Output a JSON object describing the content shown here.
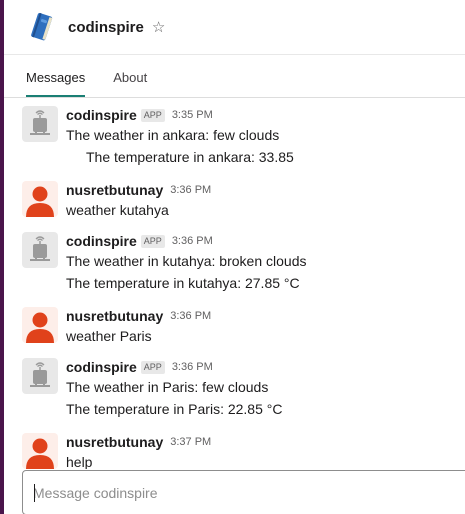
{
  "header": {
    "app_name": "codinspire",
    "logo_icon": "notebook-icon",
    "star_icon": "star-outline-icon"
  },
  "tabs": [
    {
      "label": "Messages",
      "active": true
    },
    {
      "label": "About",
      "active": false
    }
  ],
  "messages": [
    {
      "sender": "codinspire",
      "is_app": true,
      "badge": "APP",
      "time": "3:35 PM",
      "avatar_icon": "robot-icon",
      "lines": [
        "The weather in ankara:  few clouds",
        "The temperature in ankara:  33.85"
      ]
    },
    {
      "sender": "nusretbutunay",
      "is_app": false,
      "time": "3:36 PM",
      "avatar_icon": "user-avatar-icon",
      "lines": [
        "weather kutahya"
      ]
    },
    {
      "sender": "codinspire",
      "is_app": true,
      "badge": "APP",
      "time": "3:36 PM",
      "avatar_icon": "robot-icon",
      "lines": [
        "The weather in kutahya:  broken clouds",
        "The temperature in kutahya:  27.85 °C"
      ]
    },
    {
      "sender": "nusretbutunay",
      "is_app": false,
      "time": "3:36 PM",
      "avatar_icon": "user-avatar-icon",
      "lines": [
        "weather Paris"
      ]
    },
    {
      "sender": "codinspire",
      "is_app": true,
      "badge": "APP",
      "time": "3:36 PM",
      "avatar_icon": "robot-icon",
      "lines": [
        "The weather in Paris:  few clouds",
        "The temperature in Paris:  22.85 °C"
      ]
    },
    {
      "sender": "nusretbutunay",
      "is_app": false,
      "time": "3:37 PM",
      "avatar_icon": "user-avatar-icon",
      "lines": [
        "help"
      ]
    }
  ],
  "composer": {
    "placeholder": "Message codinspire",
    "value": ""
  },
  "colors": {
    "accent": "#1a7f74",
    "sidebar": "#4a154b",
    "user_avatar": "#e0421b",
    "bot_avatar": "#9a9a9a"
  }
}
